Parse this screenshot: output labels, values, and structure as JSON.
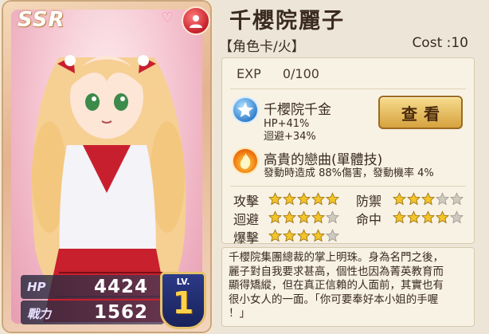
{
  "card": {
    "rarity": "SSR",
    "hp_label": "HP",
    "hp_value": "4424",
    "power_label": "戰力",
    "power_value": "1562",
    "level_label": "LV.",
    "level_value": "1"
  },
  "character": {
    "name": "千櫻院麗子",
    "type": "【角色卡/火】",
    "cost": "Cost :10"
  },
  "exp": {
    "label": "EXP",
    "value": "0/100"
  },
  "skills": [
    {
      "icon": "star-badge-icon",
      "name": "千櫻院千金",
      "desc_line1": "HP+41%",
      "desc_line2": "迴避+34%"
    },
    {
      "icon": "flame-icon",
      "name": "高貴的戀曲(單體技)",
      "desc_line1": "發動時造成 88%傷害，發動機率 4%"
    }
  ],
  "view_button": "查看",
  "stats": [
    {
      "label": "攻擊",
      "stars": 5,
      "max": 5
    },
    {
      "label": "防禦",
      "stars": 3,
      "max": 5
    },
    {
      "label": "迴避",
      "stars": 4,
      "max": 5
    },
    {
      "label": "命中",
      "stars": 4,
      "max": 5
    },
    {
      "label": "爆擊",
      "stars": 4,
      "max": 5
    }
  ],
  "description": {
    "line1": "千櫻院集團總裁的掌上明珠。身為名門之後，",
    "line2": "麗子對自我要求甚高，個性也因為菁英教育而",
    "line3": "顯得矯縱，但在真正信賴的人面前，其實也有",
    "line4": "很小女人的一面。「你可要奉好本小姐的手喔",
    "line5": "！」"
  },
  "colors": {
    "star_on": "#f2c42a",
    "star_off": "#cfcac0",
    "accent_gold": "#d6a23e"
  }
}
